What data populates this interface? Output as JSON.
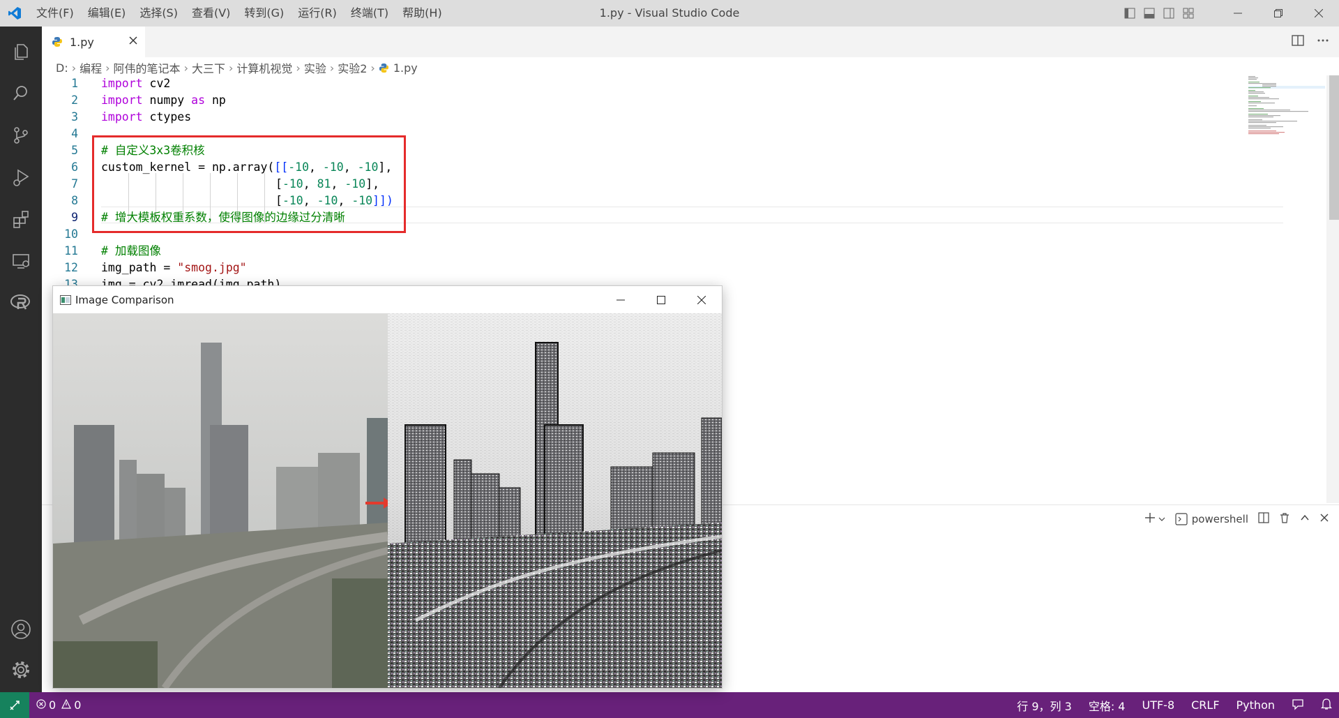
{
  "window": {
    "title": "1.py - Visual Studio Code"
  },
  "menu": [
    "文件(F)",
    "编辑(E)",
    "选择(S)",
    "查看(V)",
    "转到(G)",
    "运行(R)",
    "终端(T)",
    "帮助(H)"
  ],
  "tab": {
    "label": "1.py"
  },
  "breadcrumbs": [
    "D:",
    "编程",
    "阿伟的笔记本",
    "大三下",
    "计算机视觉",
    "实验",
    "实验2",
    "1.py"
  ],
  "code_lines": [
    {
      "n": "1"
    },
    {
      "n": "2"
    },
    {
      "n": "3"
    },
    {
      "n": "4"
    },
    {
      "n": "5"
    },
    {
      "n": "6"
    },
    {
      "n": "7"
    },
    {
      "n": "8"
    },
    {
      "n": "9"
    },
    {
      "n": "10"
    },
    {
      "n": "11"
    },
    {
      "n": "12"
    },
    {
      "n": "13"
    }
  ],
  "code": {
    "l1_kw": "import",
    "l1_rest": " cv2",
    "l2_kw": "import",
    "l2_mid": " numpy ",
    "l2_as": "as",
    "l2_rest": " np",
    "l3_kw": "import",
    "l3_rest": " ctypes",
    "l5": "# 自定义3x3卷积核",
    "l6_a": "custom_kernel = np.array(",
    "l6_br": "[[",
    "l6_n1": "-10",
    "l6_c1": ", ",
    "l6_n2": "-10",
    "l6_c2": ", ",
    "l6_n3": "-10",
    "l6_end": "],",
    "l7_br": "[",
    "l7_n1": "-10",
    "l7_c1": ", ",
    "l7_n2": "81",
    "l7_c2": ", ",
    "l7_n3": "-10",
    "l7_end": "],",
    "l8_br": "[",
    "l8_n1": "-10",
    "l8_c1": ", ",
    "l8_n2": "-10",
    "l8_c2": ", ",
    "l8_n3": "-10",
    "l8_end": "]])",
    "l9": "# 增大模板权重系数，使得图像的边缘过分清晰",
    "l11": "# 加载图像",
    "l12_a": "img_path = ",
    "l12_s": "\"smog.jpg\"",
    "l13": "img = cv2.imread(img_path)"
  },
  "terminal": {
    "shell": "powershell"
  },
  "image_window": {
    "title": "Image Comparison"
  },
  "status": {
    "errors": "0",
    "warnings": "0",
    "position": "行 9，列 3",
    "spaces": "空格: 4",
    "encoding": "UTF-8",
    "eol": "CRLF",
    "language": "Python"
  }
}
